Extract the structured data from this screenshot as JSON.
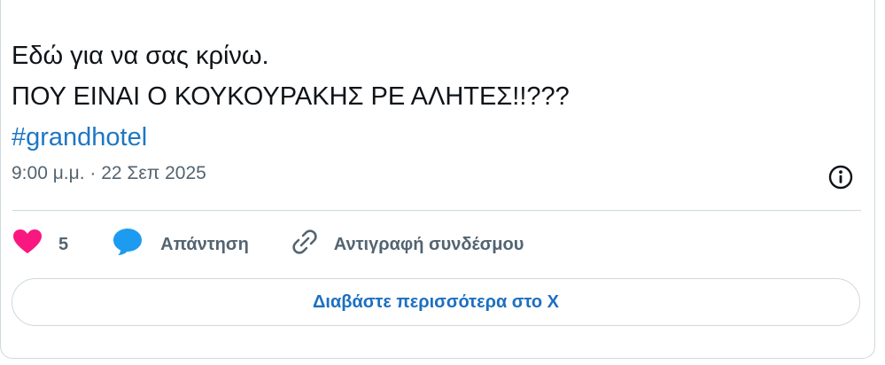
{
  "tweet": {
    "lines": [
      "Εδώ για να σας κρίνω.",
      "ΠΟΥ ΕΙΝΑΙ Ο ΚΟΥΚΟΥΡΑΚΗΣ ΡΕ ΑΛΗΤΕΣ!!???"
    ],
    "hashtag": "#grandhotel",
    "timestamp": "9:00 μ.μ. · 22 Σεπ 2025"
  },
  "actions": {
    "like_count": "5",
    "reply_label": "Απάντηση",
    "copy_link_label": "Αντιγραφή συνδέσμου"
  },
  "read_more_label": "Διαβάστε περισσότερα στο X",
  "colors": {
    "heart": "#f91880",
    "reply_bubble": "#1d9bf0",
    "link": "#1d77c3",
    "muted": "#536471"
  },
  "icons": [
    "info-icon",
    "heart-icon",
    "reply-bubble-icon",
    "link-icon"
  ]
}
